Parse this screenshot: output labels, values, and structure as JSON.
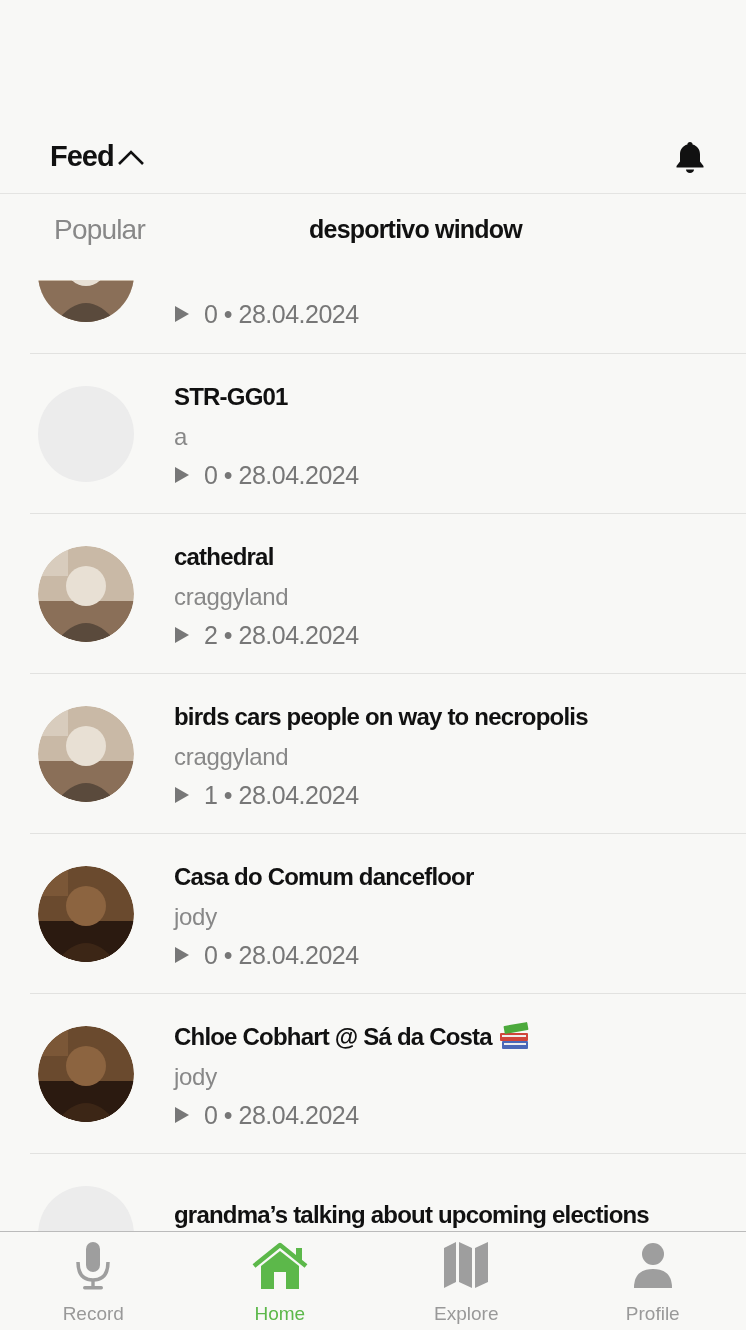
{
  "header": {
    "title": "Feed",
    "expanded": true
  },
  "tabs": [
    {
      "label": "Popular",
      "selected": false
    },
    {
      "label": "desportivo window",
      "selected": true
    }
  ],
  "posts": [
    {
      "meta": "0 • 28.04.2024"
    },
    {
      "avatar": {
        "kind": "blank"
      },
      "title": "STR-GG01",
      "author": "a",
      "meta": "0 • 28.04.2024"
    },
    {
      "title": "cathedral",
      "author": "craggyland",
      "meta": "2 • 28.04.2024"
    },
    {
      "title": "birds cars people on way to necropolis",
      "author": "craggyland",
      "meta": "1 • 28.04.2024"
    },
    {
      "title": "Casa do Comum dancefloor",
      "author": "jody",
      "meta": "0 • 28.04.2024"
    },
    {
      "title": "Chloe Cobhart @ Sá da Costa",
      "emoji": {
        "kind": "books"
      },
      "author": "jody",
      "meta": "0 • 28.04.2024"
    },
    {
      "avatar": {
        "kind": "blank"
      },
      "title": "grandma’s talking about upcoming elections"
    }
  ],
  "nav": [
    {
      "label": "Record",
      "kind": "record",
      "selected": false
    },
    {
      "label": "Home",
      "kind": "home",
      "selected": true
    },
    {
      "label": "Explore",
      "kind": "explore",
      "selected": false
    },
    {
      "label": "Profile",
      "kind": "profile",
      "selected": false
    }
  ]
}
